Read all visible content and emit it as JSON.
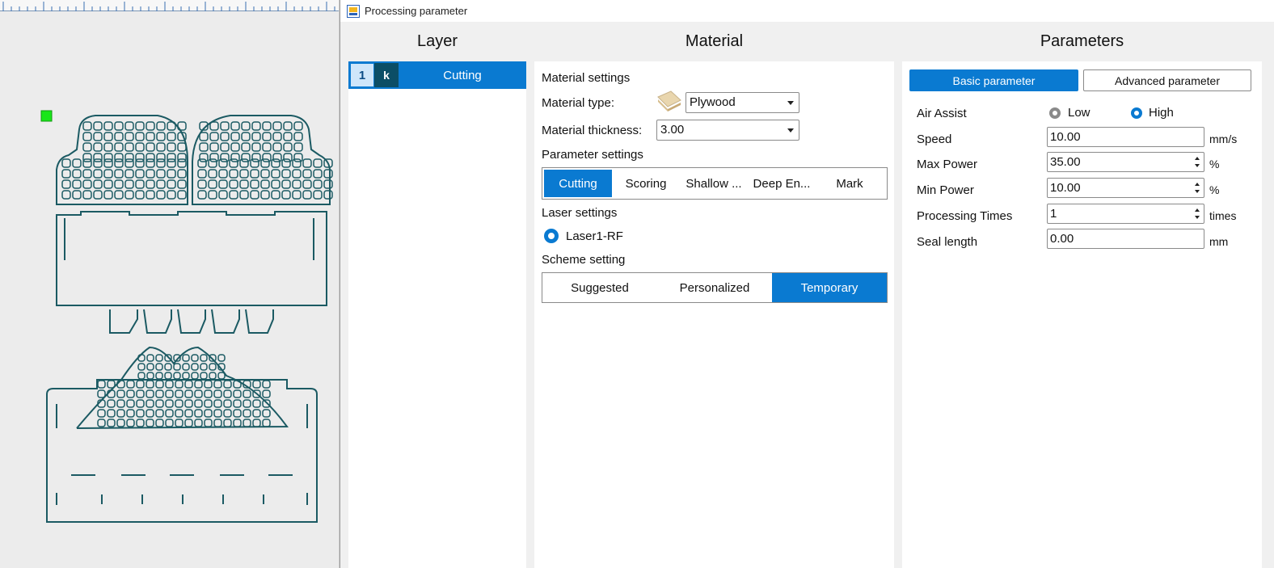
{
  "window": {
    "title": "Processing parameter"
  },
  "columns": {
    "layer": "Layer",
    "material": "Material",
    "parameters": "Parameters"
  },
  "layer": {
    "number": "1",
    "mode": "k",
    "name": "Cutting"
  },
  "material": {
    "settings_heading": "Material settings",
    "type_label": "Material type:",
    "type_value": "Plywood",
    "thickness_label": "Material thickness:",
    "thickness_value": "3.00",
    "parameter_settings_heading": "Parameter settings",
    "parameter_tabs": [
      "Cutting",
      "Scoring",
      "Shallow ...",
      "Deep En...",
      "Mark"
    ],
    "parameter_tab_active": 0,
    "laser_settings_heading": "Laser settings",
    "laser_option": "Laser1-RF",
    "scheme_heading": "Scheme setting",
    "scheme_tabs": [
      "Suggested",
      "Personalized",
      "Temporary"
    ],
    "scheme_tab_active": 2
  },
  "parameters": {
    "basic_button": "Basic parameter",
    "advanced_button": "Advanced parameter",
    "air_assist_label": "Air Assist",
    "air_assist_low": "Low",
    "air_assist_high": "High",
    "air_assist_selected": "High",
    "speed_label": "Speed",
    "speed_value": "10.00",
    "speed_unit": "mm/s",
    "max_power_label": "Max Power",
    "max_power_value": "35.00",
    "max_power_unit": "%",
    "min_power_label": "Min Power",
    "min_power_value": "10.00",
    "min_power_unit": "%",
    "processing_times_label": "Processing Times",
    "processing_times_value": "1",
    "processing_times_unit": "times",
    "seal_length_label": "Seal length",
    "seal_length_value": "0.00",
    "seal_length_unit": "mm"
  },
  "colors": {
    "accent": "#0a7ad1",
    "design_stroke": "#1b5a63",
    "marker": "#19e619"
  }
}
